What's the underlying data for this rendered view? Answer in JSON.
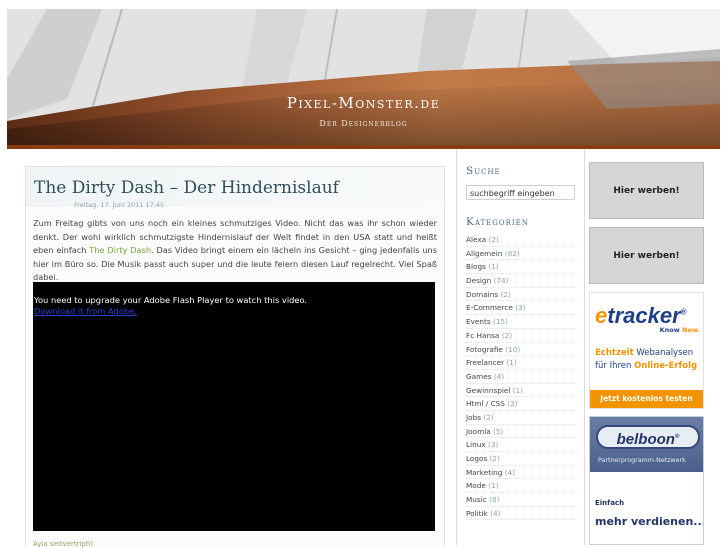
{
  "site": {
    "title": "Pixel-Monster.de",
    "subtitle": "Der Designerblog"
  },
  "post": {
    "title": "The Dirty Dash – Der Hindernislauf",
    "date": "Freitag, 17. Juni 2011 17:45",
    "body_part1": "Zum Freitag gibts von uns noch ein kleines schmutziges Video. Nicht das was ihr schon wieder denkt. Der wohl wirklich schmutzigste Hindernislauf der Welt findet in den USA statt und heißt eben einfach ",
    "body_link": "The Dirty Dash",
    "body_part2": ". Das Video bringt einem ein lächeln ins Gesicht – ging jedenfalls uns hier im Büro so. Die Musik passt auch super und die leute feiern diesen Lauf regelrecht. Viel Spaß dabei.",
    "flash_message": "You need to upgrade your Adobe Flash Player to watch this video.",
    "flash_link": "Download it from Adobe.",
    "more_link": "Ayia seitvertriph)"
  },
  "sidebar": {
    "search_heading": "Suche",
    "search_value": "suchbegriff eingeben",
    "categories_heading": "Kategorien",
    "categories": [
      {
        "name": "Alexa",
        "count": "(2)"
      },
      {
        "name": "Allgemein",
        "count": "(82)"
      },
      {
        "name": "Blogs",
        "count": "(1)"
      },
      {
        "name": "Design",
        "count": "(74)"
      },
      {
        "name": "Domains",
        "count": "(2)"
      },
      {
        "name": "E-Commerce",
        "count": "(3)"
      },
      {
        "name": "Events",
        "count": "(15)"
      },
      {
        "name": "Fc Hansa",
        "count": "(2)"
      },
      {
        "name": "Fotografie",
        "count": "(10)"
      },
      {
        "name": "Freelancer",
        "count": "(1)"
      },
      {
        "name": "Games",
        "count": "(4)"
      },
      {
        "name": "Gewinnspiel",
        "count": "(1)"
      },
      {
        "name": "Html / CSS",
        "count": "(2)"
      },
      {
        "name": "Jobs",
        "count": "(2)"
      },
      {
        "name": "Joomla",
        "count": "(5)"
      },
      {
        "name": "Linux",
        "count": "(3)"
      },
      {
        "name": "Logos",
        "count": "(2)"
      },
      {
        "name": "Marketing",
        "count": "(4)"
      },
      {
        "name": "Mode",
        "count": "(1)"
      },
      {
        "name": "Music",
        "count": "(8)"
      },
      {
        "name": "Politik",
        "count": "(4)"
      }
    ]
  },
  "ads": {
    "ad1": "Hier werben!",
    "ad2": "Hier werben!",
    "etracker": {
      "logo_e": "e",
      "logo_rest": "tracker",
      "reg": "®",
      "tag_know": "Know",
      "tag_now": "Now.",
      "line1_accent": "Echtzeit",
      "line1_rest": " Webanalysen",
      "line2_start": "für Ihren ",
      "line2_accent": "Online-Erfolg",
      "button": "Jetzt kostenlos testen"
    },
    "belboon": {
      "logo": "belboon",
      "reg": "®",
      "subtitle": "Partnerprogramm-Netzwerk",
      "line1": "Einfach",
      "line2": "mehr verdienen..."
    }
  },
  "colors": {
    "accent_red": "#8a3b12",
    "link_green": "#7aa43a",
    "heading_teal": "#3f6a78",
    "etracker_orange": "#f29400",
    "etracker_blue": "#1f3f8a"
  }
}
